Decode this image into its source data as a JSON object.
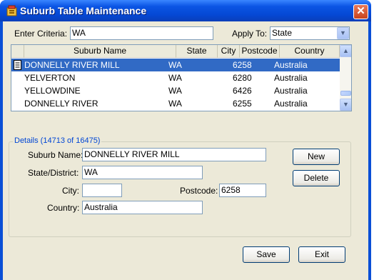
{
  "window": {
    "title": "Suburb Table Maintenance",
    "close_label": "✕"
  },
  "criteria": {
    "label": "Enter Criteria:",
    "value": "WA"
  },
  "apply_to": {
    "label": "Apply To:",
    "value": "State"
  },
  "grid": {
    "columns": [
      "Suburb Name",
      "State",
      "City",
      "Postcode",
      "Country"
    ],
    "rows": [
      {
        "suburb": "DONNELLY RIVER MILL",
        "state": "WA",
        "city": "",
        "postcode": "6258",
        "country": "Australia",
        "selected": true
      },
      {
        "suburb": "YELVERTON",
        "state": "WA",
        "city": "",
        "postcode": "6280",
        "country": "Australia",
        "selected": false
      },
      {
        "suburb": "YELLOWDINE",
        "state": "WA",
        "city": "",
        "postcode": "6426",
        "country": "Australia",
        "selected": false
      },
      {
        "suburb": "DONNELLY RIVER",
        "state": "WA",
        "city": "",
        "postcode": "6255",
        "country": "Australia",
        "selected": false
      }
    ]
  },
  "details": {
    "title": "Details (14713 of 16475)",
    "suburb_label": "Suburb Name:",
    "suburb_value": "DONNELLY RIVER MILL",
    "state_label": "State/District:",
    "state_value": "WA",
    "city_label": "City:",
    "city_value": "",
    "postcode_label": "Postcode:",
    "postcode_value": "6258",
    "country_label": "Country:",
    "country_value": "Australia"
  },
  "buttons": {
    "new": "New",
    "delete": "Delete",
    "save": "Save",
    "exit": "Exit"
  },
  "colors": {
    "title_bar": "#0548d4",
    "selection": "#316ac5",
    "client": "#ece9d8",
    "group_title": "#0046d5"
  }
}
